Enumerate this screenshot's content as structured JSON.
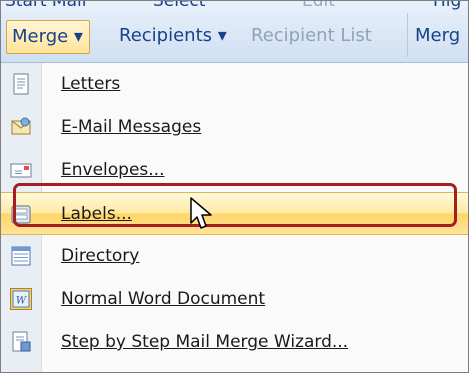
{
  "ribbon": {
    "top_labels": [
      "Start Mail",
      "Select",
      "Edit",
      "Hig"
    ],
    "buttons": [
      {
        "label": "Merge ▾",
        "state": "active"
      },
      {
        "label": "Recipients ▾",
        "state": "normal"
      },
      {
        "label": "Recipient List",
        "state": "disabled"
      },
      {
        "label": "Merg",
        "state": "normal"
      }
    ]
  },
  "menu": {
    "items": [
      {
        "label": "Letters",
        "icon": "letters-icon"
      },
      {
        "label": "E-Mail Messages",
        "icon": "email-envelope-icon"
      },
      {
        "label": "Envelopes...",
        "icon": "envelopes-icon"
      },
      {
        "label": "Labels...",
        "icon": "labels-icon",
        "highlighted": true
      },
      {
        "label": "Directory",
        "icon": "directory-icon"
      },
      {
        "label": "Normal Word Document",
        "icon": "word-document-icon"
      },
      {
        "label": "Step by Step Mail Merge Wizard...",
        "icon": "wizard-icon"
      }
    ]
  },
  "colors": {
    "highlight": "#ffe39a",
    "callout_outline": "#a51e22",
    "ribbon_text": "#15428b"
  }
}
